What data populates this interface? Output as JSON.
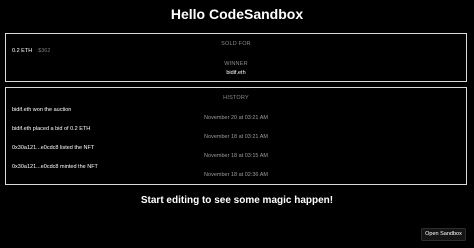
{
  "header": {
    "title": "Hello CodeSandbox"
  },
  "sold": {
    "label": "SOLD FOR",
    "price_eth": "0.2 ETH",
    "price_usd": "$362",
    "winner_label": "WINNER",
    "winner_name": "bidif.eth"
  },
  "history": {
    "label": "HISTORY",
    "events": [
      {
        "text": "bidif.eth won the auction",
        "time": "November 20 at 03:21 AM"
      },
      {
        "text": "bidif.eth placed a bid of 0.2 ETH",
        "time": "November 18 at 03:21 AM"
      },
      {
        "text": "0x30a121...e0cdc8 listed the NFT",
        "time": "November 18 at 03:15 AM"
      },
      {
        "text": "0x30a121...e0cdc8 minted the NFT",
        "time": "November 18 at 02:36 AM"
      }
    ]
  },
  "footer": {
    "tagline": "Start editing to see some magic happen!",
    "open_sandbox_label": "Open Sandbox"
  }
}
